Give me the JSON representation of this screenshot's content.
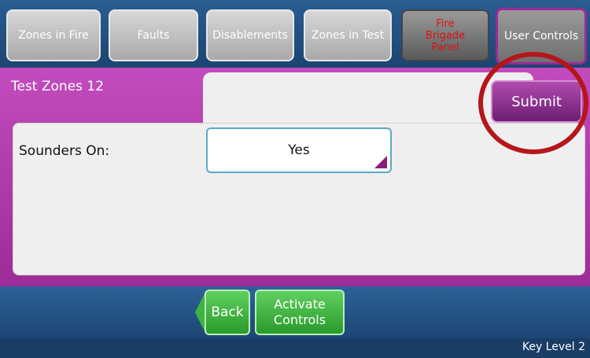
{
  "tabs": [
    {
      "label": "Zones in Fire"
    },
    {
      "label": "Faults"
    },
    {
      "label": "Disablements"
    },
    {
      "label": "Zones in Test"
    },
    {
      "line1": "Fire",
      "line2": "Brigade",
      "line3": "Panel"
    },
    {
      "label": "User Controls"
    }
  ],
  "zone": {
    "title": "Test Zones 12"
  },
  "form": {
    "sounders_label": "Sounders On:",
    "sounders_value": "Yes"
  },
  "actions": {
    "submit": "Submit",
    "back": "Back",
    "activate": "Activate Controls"
  },
  "status": {
    "key_level": "Key Level 2"
  },
  "colors": {
    "accent": "#9c2c98",
    "alert_ring": "#b5161a",
    "button_green": "#3eb33e"
  }
}
